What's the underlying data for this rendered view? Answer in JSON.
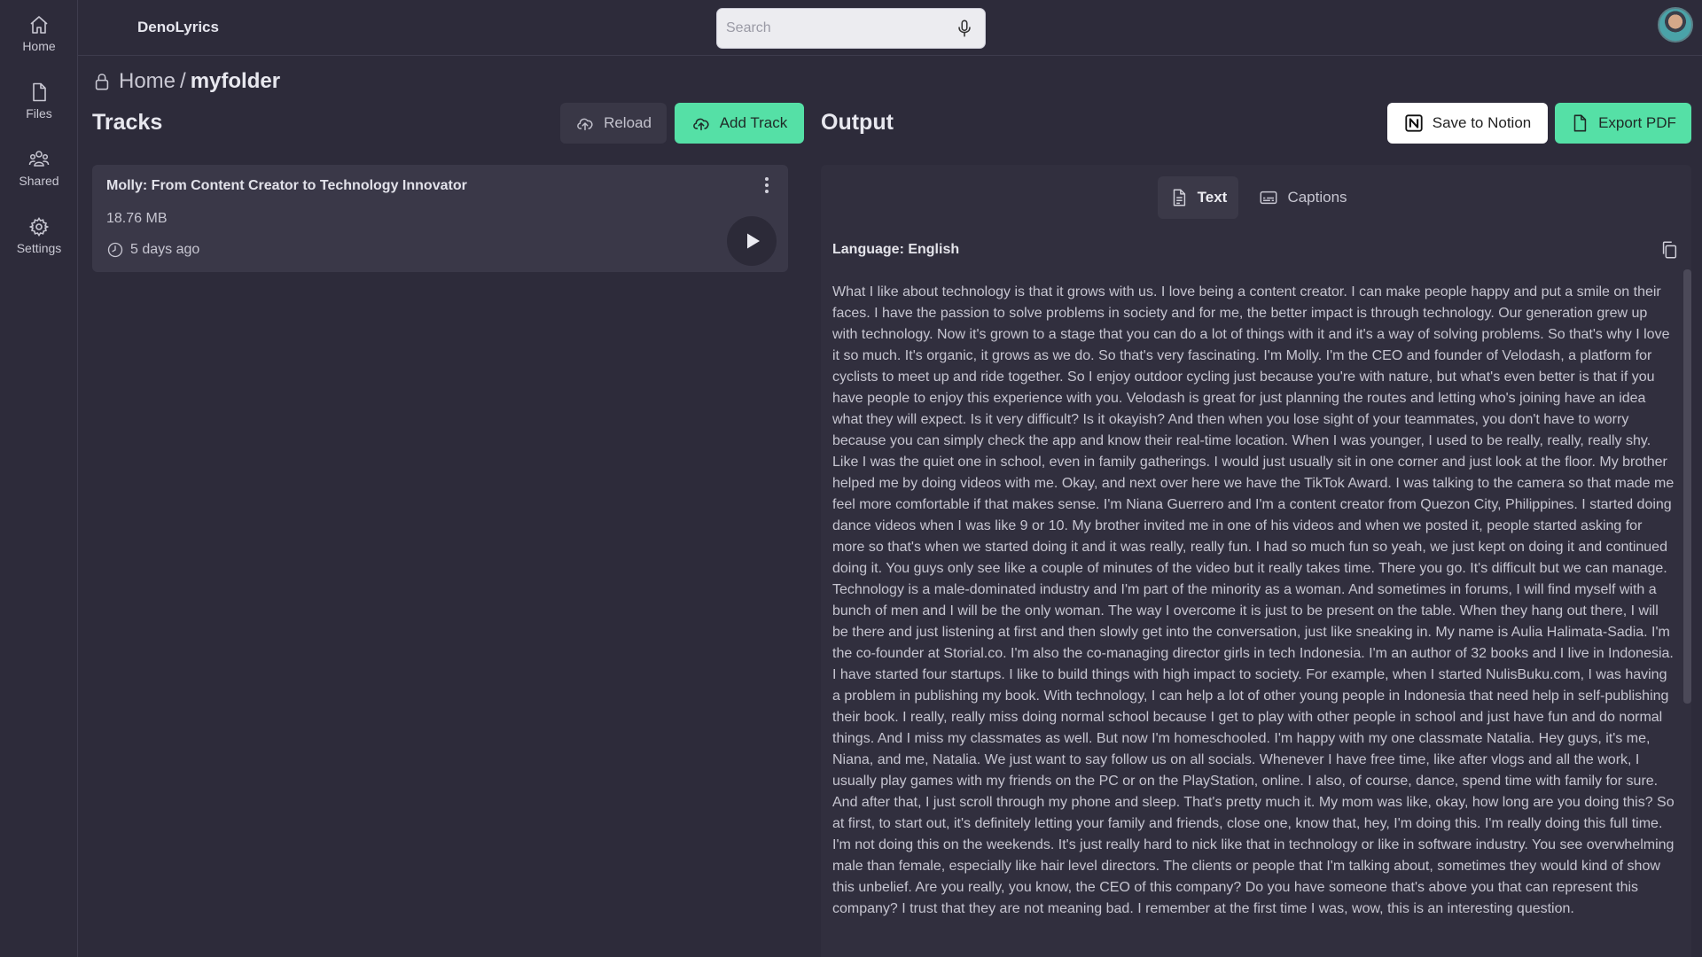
{
  "sidebar": {
    "items": [
      {
        "label": "Home",
        "icon": "home-icon"
      },
      {
        "label": "Files",
        "icon": "file-icon"
      },
      {
        "label": "Shared",
        "icon": "users-icon"
      },
      {
        "label": "Settings",
        "icon": "gear-icon"
      }
    ]
  },
  "header": {
    "app_title": "DenoLyrics",
    "search": {
      "placeholder": "Search",
      "value": ""
    }
  },
  "breadcrumb": {
    "home": "Home",
    "separator": "/",
    "folder": "myfolder"
  },
  "tracks": {
    "title": "Tracks",
    "reload_label": "Reload",
    "add_label": "Add Track",
    "items": [
      {
        "title": "Molly: From Content Creator to Technology Innovator",
        "size": "18.76 MB",
        "time": "5 days ago"
      }
    ]
  },
  "output": {
    "title": "Output",
    "notion_label": "Save to Notion",
    "export_label": "Export PDF",
    "tabs": [
      {
        "label": "Text",
        "active": true
      },
      {
        "label": "Captions",
        "active": false
      }
    ],
    "language": "Language: English",
    "transcript": "What I like about technology is that it grows with us. I love being a content creator. I can make people happy and put a smile on their faces. I have the passion to solve problems in society and for me, the better impact is through technology. Our generation grew up with technology. Now it's grown to a stage that you can do a lot of things with it and it's a way of solving problems. So that's why I love it so much. It's organic, it grows as we do. So that's very fascinating. I'm Molly. I'm the CEO and founder of Velodash, a platform for cyclists to meet up and ride together. So I enjoy outdoor cycling just because you're with nature, but what's even better is that if you have people to enjoy this experience with you. Velodash is great for just planning the routes and letting who's joining have an idea what they will expect. Is it very difficult? Is it okayish? And then when you lose sight of your teammates, you don't have to worry because you can simply check the app and know their real-time location. When I was younger, I used to be really, really, really shy. Like I was the quiet one in school, even in family gatherings. I would just usually sit in one corner and just look at the floor. My brother helped me by doing videos with me. Okay, and next over here we have the TikTok Award. I was talking to the camera so that made me feel more comfortable if that makes sense. I'm Niana Guerrero and I'm a content creator from Quezon City, Philippines. I started doing dance videos when I was like 9 or 10. My brother invited me in one of his videos and when we posted it, people started asking for more so that's when we started doing it and it was really, really fun. I had so much fun so yeah, we just kept on doing it and continued doing it. You guys only see like a couple of minutes of the video but it really takes time. There you go. It's difficult but we can manage. Technology is a male-dominated industry and I'm part of the minority as a woman. And sometimes in forums, I will find myself with a bunch of men and I will be the only woman. The way I overcome it is just to be present on the table. When they hang out there, I will be there and just listening at first and then slowly get into the conversation, just like sneaking in. My name is Aulia Halimata-Sadia. I'm the co-founder at Storial.co. I'm also the co-managing director girls in tech Indonesia. I'm an author of 32 books and I live in Indonesia. I have started four startups. I like to build things with high impact to society. For example, when I started NulisBuku.com, I was having a problem in publishing my book. With technology, I can help a lot of other young people in Indonesia that need help in self-publishing their book. I really, really miss doing normal school because I get to play with other people in school and just have fun and do normal things. And I miss my classmates as well. But now I'm homeschooled. I'm happy with my one classmate Natalia. Hey guys, it's me, Niana, and me, Natalia. We just want to say follow us on all socials. Whenever I have free time, like after vlogs and all the work, I usually play games with my friends on the PC or on the PlayStation, online. I also, of course, dance, spend time with family for sure. And after that, I just scroll through my phone and sleep. That's pretty much it. My mom was like, okay, how long are you doing this? So at first, to start out, it's definitely letting your family and friends, close one, know that, hey, I'm doing this. I'm really doing this full time. I'm not doing this on the weekends. It's just really hard to nick like that in technology or like in software industry. You see overwhelming male than female, especially like hair level directors. The clients or people that I'm talking about, sometimes they would kind of show this unbelief. Are you really, you know, the CEO of this company? Do you have someone that's above you that can represent this company? I trust that they are not meaning bad. I remember at the first time I was, wow, this is an interesting question."
  },
  "colors": {
    "background": "#2d2b3a",
    "accent": "#55e0a6",
    "card": "#3a3848"
  }
}
